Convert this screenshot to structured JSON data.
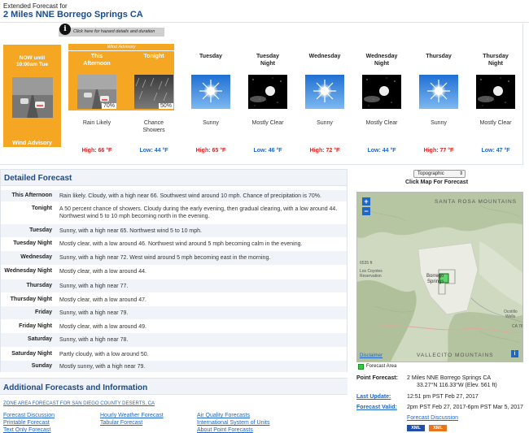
{
  "header": {
    "subtitle": "Extended Forecast for",
    "title": "2 Miles NNE Borrego Springs CA"
  },
  "hazard": {
    "info_tooltip": "Click here for hazard details and duration",
    "advisory_band": "Wind Advisory"
  },
  "now": {
    "line1": "NOW until",
    "line2": "10:00am Tue",
    "label": "Wind Advisory"
  },
  "periods": [
    {
      "name1": "This",
      "name2": "Afternoon",
      "icon": "rain-icon",
      "pct": "70%",
      "desc1": "Rain Likely",
      "desc2": "",
      "temp": "High: 66 °F",
      "kind": "hi"
    },
    {
      "name1": "Tonight",
      "name2": "",
      "icon": "showers-night-icon",
      "pct": "50%",
      "desc1": "Chance",
      "desc2": "Showers",
      "temp": "Low: 44 °F",
      "kind": "lo"
    },
    {
      "name1": "Tuesday",
      "name2": "",
      "icon": "sunny-icon",
      "pct": "",
      "desc1": "Sunny",
      "desc2": "",
      "temp": "High: 65 °F",
      "kind": "hi"
    },
    {
      "name1": "Tuesday",
      "name2": "Night",
      "icon": "clear-night-icon",
      "pct": "",
      "desc1": "Mostly Clear",
      "desc2": "",
      "temp": "Low: 46 °F",
      "kind": "lo"
    },
    {
      "name1": "Wednesday",
      "name2": "",
      "icon": "sunny-icon",
      "pct": "",
      "desc1": "Sunny",
      "desc2": "",
      "temp": "High: 72 °F",
      "kind": "hi"
    },
    {
      "name1": "Wednesday",
      "name2": "Night",
      "icon": "clear-night-icon",
      "pct": "",
      "desc1": "Mostly Clear",
      "desc2": "",
      "temp": "Low: 44 °F",
      "kind": "lo"
    },
    {
      "name1": "Thursday",
      "name2": "",
      "icon": "sunny-icon",
      "pct": "",
      "desc1": "Sunny",
      "desc2": "",
      "temp": "High: 77 °F",
      "kind": "hi"
    },
    {
      "name1": "Thursday",
      "name2": "Night",
      "icon": "clear-night-icon",
      "pct": "",
      "desc1": "Mostly Clear",
      "desc2": "",
      "temp": "Low: 47 °F",
      "kind": "lo"
    }
  ],
  "detailed": {
    "title": "Detailed Forecast",
    "rows": [
      {
        "label": "This Afternoon",
        "text": "Rain likely. Cloudy, with a high near 66. Southwest wind around 10 mph. Chance of precipitation is 70%."
      },
      {
        "label": "Tonight",
        "text": "A 50 percent chance of showers. Cloudy during the early evening, then gradual clearing, with a low around 44. Northwest wind 5 to 10 mph becoming north in the evening."
      },
      {
        "label": "Tuesday",
        "text": "Sunny, with a high near 65. Northwest wind 5 to 10 mph."
      },
      {
        "label": "Tuesday Night",
        "text": "Mostly clear, with a low around 46. Northwest wind around 5 mph becoming calm in the evening."
      },
      {
        "label": "Wednesday",
        "text": "Sunny, with a high near 72. West wind around 5 mph becoming east in the morning."
      },
      {
        "label": "Wednesday Night",
        "text": "Mostly clear, with a low around 44."
      },
      {
        "label": "Thursday",
        "text": "Sunny, with a high near 77."
      },
      {
        "label": "Thursday Night",
        "text": "Mostly clear, with a low around 47."
      },
      {
        "label": "Friday",
        "text": "Sunny, with a high near 79."
      },
      {
        "label": "Friday Night",
        "text": "Mostly clear, with a low around 49."
      },
      {
        "label": "Saturday",
        "text": "Sunny, with a high near 78."
      },
      {
        "label": "Saturday Night",
        "text": "Partly cloudy, with a low around 50."
      },
      {
        "label": "Sunday",
        "text": "Mostly sunny, with a high near 79."
      }
    ]
  },
  "additional": {
    "title": "Additional Forecasts and Information",
    "zone_link": "ZONE AREA FORECAST FOR SAN DIEGO COUNTY DESERTS, CA",
    "links": [
      [
        "Forecast Discussion",
        "Printable Forecast",
        "Text Only Forecast"
      ],
      [
        "Hourly Weather Forecast",
        "Tabular Forecast"
      ],
      [
        "Air Quality Forecasts",
        "International System of Units",
        "About Point Forecasts"
      ]
    ]
  },
  "map": {
    "select_value": "Topographic",
    "caption": "Click Map For Forecast",
    "labels": {
      "santa_rosa": "SANTA ROSA MOUNTAINS",
      "los_coyotes_1": "Los Coyotes",
      "los_coyotes_2": "Reservation",
      "elev": "6535 ft",
      "borrego_1": "Borrego",
      "borrego_2": "Springs",
      "ocotillo_1": "Ocotillo",
      "ocotillo_2": "Wells",
      "ca78": "CA 78",
      "vallecito": "VALLECITO MOUNTAINS",
      "zoom_in": "+",
      "zoom_out": "−",
      "disclaimer": "Disclaimer",
      "info": "i"
    },
    "legend": "Forecast Area"
  },
  "point": {
    "forecast_label": "Point Forecast:",
    "forecast_line1": "2 Miles NNE Borrego Springs CA",
    "forecast_line2": "33.27°N 116.33°W (Elev. 561 ft)",
    "update_label": "Last Update:",
    "update_value": "12:51 pm PST Feb 27, 2017",
    "valid_label": "Forecast Valid:",
    "valid_value": "2pm PST Feb 27, 2017-6pm PST Mar 5, 2017",
    "discussion": "Forecast Discussion",
    "xml": "XML",
    "kml": "XML"
  },
  "colors": {
    "accent_blue": "#1a4b8c",
    "advisory_orange": "#f5a623",
    "high_red": "#e02020",
    "low_blue": "#1f66c7"
  }
}
